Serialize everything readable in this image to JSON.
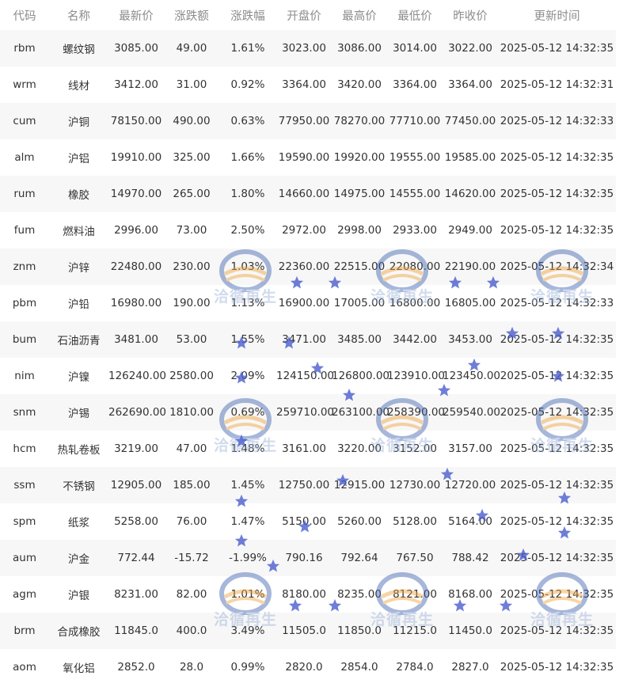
{
  "headers": [
    "代码",
    "名称",
    "最新价",
    "涨跌额",
    "涨跌幅",
    "开盘价",
    "最高价",
    "最低价",
    "昨收价",
    "更新时间"
  ],
  "rows": [
    {
      "code": "rbm",
      "name": "螺纹钢",
      "last": "3085.00",
      "chg": "49.00",
      "pct": "1.61%",
      "open": "3023.00",
      "high": "3086.00",
      "low": "3014.00",
      "prev": "3022.00",
      "time": "2025-05-12 14:32:35"
    },
    {
      "code": "wrm",
      "name": "线材",
      "last": "3412.00",
      "chg": "31.00",
      "pct": "0.92%",
      "open": "3364.00",
      "high": "3420.00",
      "low": "3364.00",
      "prev": "3364.00",
      "time": "2025-05-12 14:32:31"
    },
    {
      "code": "cum",
      "name": "沪铜",
      "last": "78150.00",
      "chg": "490.00",
      "pct": "0.63%",
      "open": "77950.00",
      "high": "78270.00",
      "low": "77710.00",
      "prev": "77450.00",
      "time": "2025-05-12 14:32:33"
    },
    {
      "code": "alm",
      "name": "沪铝",
      "last": "19910.00",
      "chg": "325.00",
      "pct": "1.66%",
      "open": "19590.00",
      "high": "19920.00",
      "low": "19555.00",
      "prev": "19585.00",
      "time": "2025-05-12 14:32:35"
    },
    {
      "code": "rum",
      "name": "橡胶",
      "last": "14970.00",
      "chg": "265.00",
      "pct": "1.80%",
      "open": "14660.00",
      "high": "14975.00",
      "low": "14555.00",
      "prev": "14620.00",
      "time": "2025-05-12 14:32:35"
    },
    {
      "code": "fum",
      "name": "燃料油",
      "last": "2996.00",
      "chg": "73.00",
      "pct": "2.50%",
      "open": "2972.00",
      "high": "2998.00",
      "low": "2933.00",
      "prev": "2949.00",
      "time": "2025-05-12 14:32:35"
    },
    {
      "code": "znm",
      "name": "沪锌",
      "last": "22480.00",
      "chg": "230.00",
      "pct": "1.03%",
      "open": "22360.00",
      "high": "22515.00",
      "low": "22080.00",
      "prev": "22190.00",
      "time": "2025-05-12 14:32:34"
    },
    {
      "code": "pbm",
      "name": "沪铅",
      "last": "16980.00",
      "chg": "190.00",
      "pct": "1.13%",
      "open": "16900.00",
      "high": "17005.00",
      "low": "16800.00",
      "prev": "16805.00",
      "time": "2025-05-12 14:32:33"
    },
    {
      "code": "bum",
      "name": "石油沥青",
      "last": "3481.00",
      "chg": "53.00",
      "pct": "1.55%",
      "open": "3471.00",
      "high": "3485.00",
      "low": "3442.00",
      "prev": "3453.00",
      "time": "2025-05-12 14:32:35"
    },
    {
      "code": "nim",
      "name": "沪镍",
      "last": "126240.00",
      "chg": "2580.00",
      "pct": "2.09%",
      "open": "124150.00",
      "high": "126800.00",
      "low": "123910.00",
      "prev": "123450.00",
      "time": "2025-05-12 14:32:35"
    },
    {
      "code": "snm",
      "name": "沪锡",
      "last": "262690.00",
      "chg": "1810.00",
      "pct": "0.69%",
      "open": "259710.00",
      "high": "263100.00",
      "low": "258390.00",
      "prev": "259540.00",
      "time": "2025-05-12 14:32:35"
    },
    {
      "code": "hcm",
      "name": "热轧卷板",
      "last": "3219.00",
      "chg": "47.00",
      "pct": "1.48%",
      "open": "3161.00",
      "high": "3220.00",
      "low": "3152.00",
      "prev": "3157.00",
      "time": "2025-05-12 14:32:35"
    },
    {
      "code": "ssm",
      "name": "不锈钢",
      "last": "12905.00",
      "chg": "185.00",
      "pct": "1.45%",
      "open": "12750.00",
      "high": "12915.00",
      "low": "12730.00",
      "prev": "12720.00",
      "time": "2025-05-12 14:32:35"
    },
    {
      "code": "spm",
      "name": "纸浆",
      "last": "5258.00",
      "chg": "76.00",
      "pct": "1.47%",
      "open": "5150.00",
      "high": "5260.00",
      "low": "5128.00",
      "prev": "5164.00",
      "time": "2025-05-12 14:32:35"
    },
    {
      "code": "aum",
      "name": "沪金",
      "last": "772.44",
      "chg": "-15.72",
      "pct": "-1.99%",
      "open": "790.16",
      "high": "792.64",
      "low": "767.50",
      "prev": "788.42",
      "time": "2025-05-12 14:32:35"
    },
    {
      "code": "agm",
      "name": "沪银",
      "last": "8231.00",
      "chg": "82.00",
      "pct": "1.01%",
      "open": "8180.00",
      "high": "8235.00",
      "low": "8121.00",
      "prev": "8168.00",
      "time": "2025-05-12 14:32:35"
    },
    {
      "code": "brm",
      "name": "合成橡胶",
      "last": "11845.0",
      "chg": "400.0",
      "pct": "3.49%",
      "open": "11505.0",
      "high": "11850.0",
      "low": "11215.0",
      "prev": "11450.0",
      "time": "2025-05-12 14:32:35"
    },
    {
      "code": "aom",
      "name": "氧化铝",
      "last": "2852.0",
      "chg": "28.0",
      "pct": "0.99%",
      "open": "2820.0",
      "high": "2854.0",
      "low": "2784.0",
      "prev": "2827.0",
      "time": "2025-05-12 14:32:35"
    }
  ],
  "watermark": {
    "text": "洽循再生",
    "colors": {
      "ring_blue": "#3d62b0",
      "ring_orange": "#f0a13a",
      "star": "#4a5ecf"
    }
  },
  "colors": {
    "up": "#f0282d",
    "down": "#1a9a2a",
    "flat": "#333333",
    "header": "#8c8c8c",
    "stripe": "#f7f7f7"
  }
}
